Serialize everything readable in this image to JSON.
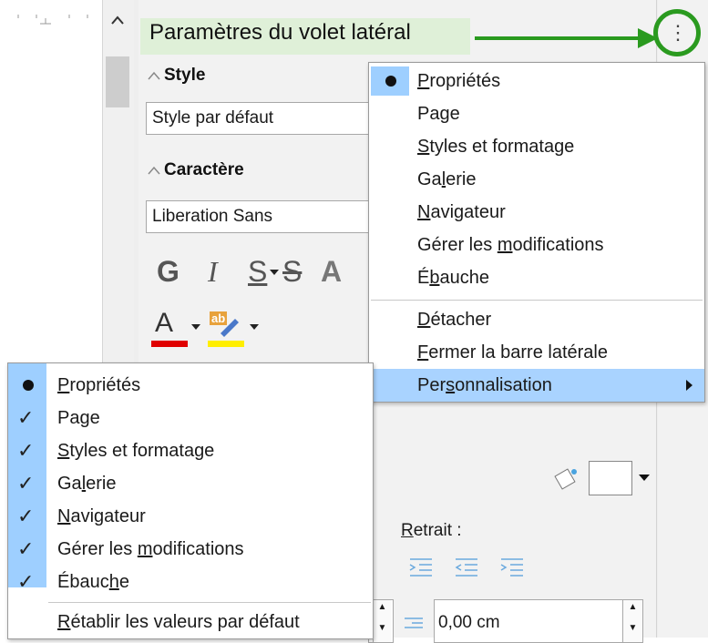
{
  "sidebar": {
    "settings_title": "Paramètres du volet latéral",
    "sections": {
      "style_header": "Style",
      "style_value": "Style par défaut",
      "character_header": "Caractère",
      "font_value": "Liberation Sans",
      "format_glyphs": {
        "bold": "G",
        "italic": "I",
        "underline": "S",
        "strike": "S",
        "shadow": "A"
      },
      "color_glyphs": {
        "font_color": "A",
        "highlight": "ab"
      }
    },
    "indent_label": "Retrait :",
    "indent_value": "0,00 cm"
  },
  "settings_menu": {
    "items": [
      {
        "label_pre": "",
        "label_u": "P",
        "label_post": "ropriétés",
        "bullet": true
      },
      {
        "label_pre": "Pa",
        "label_u": "g",
        "label_post": "e"
      },
      {
        "label_pre": "",
        "label_u": "S",
        "label_post": "tyles et formatage"
      },
      {
        "label_pre": "Ga",
        "label_u": "l",
        "label_post": "erie"
      },
      {
        "label_pre": "",
        "label_u": "N",
        "label_post": "avigateur"
      },
      {
        "label_pre": "Gérer les ",
        "label_u": "m",
        "label_post": "odifications"
      },
      {
        "label_pre": "É",
        "label_u": "b",
        "label_post": "auche"
      },
      {
        "label_pre": "",
        "label_u": "D",
        "label_post": "étacher"
      },
      {
        "label_pre": "",
        "label_u": "F",
        "label_post": "ermer la barre latérale"
      },
      {
        "label_pre": "Per",
        "label_u": "s",
        "label_post": "onnalisation"
      }
    ]
  },
  "customize_menu": {
    "items": [
      {
        "label_pre": "",
        "label_u": "P",
        "label_post": "ropriétés",
        "mark": "bullet"
      },
      {
        "label_pre": "Pa",
        "label_u": "g",
        "label_post": "e",
        "mark": "check"
      },
      {
        "label_pre": "",
        "label_u": "S",
        "label_post": "tyles et formatage",
        "mark": "check"
      },
      {
        "label_pre": "Ga",
        "label_u": "l",
        "label_post": "erie",
        "mark": "check"
      },
      {
        "label_pre": "",
        "label_u": "N",
        "label_post": "avigateur",
        "mark": "check"
      },
      {
        "label_pre": "Gérer les ",
        "label_u": "m",
        "label_post": "odifications",
        "mark": "check"
      },
      {
        "label_pre": "Ébauc",
        "label_u": "h",
        "label_post": "e",
        "mark": "check"
      },
      {
        "label_pre": "",
        "label_u": "R",
        "label_post": "établir les valeurs par défaut",
        "mark": ""
      }
    ]
  },
  "colors": {
    "annotation_green": "#2a9a1f",
    "title_band": "#dff0d8",
    "menu_highlight": "#a9d3ff",
    "check_column": "#9ecfff",
    "font_color_bar": "#e00000",
    "highlight_bar": "#ffee00"
  },
  "icons": {
    "sidebar_settings": "kebab-vertical-icon",
    "scroll_up": "chevron-up-icon",
    "submenu": "triangle-right-icon",
    "check": "check-icon",
    "radio_bullet": "bullet-icon",
    "fill_bucket": "paint-bucket-icon"
  }
}
